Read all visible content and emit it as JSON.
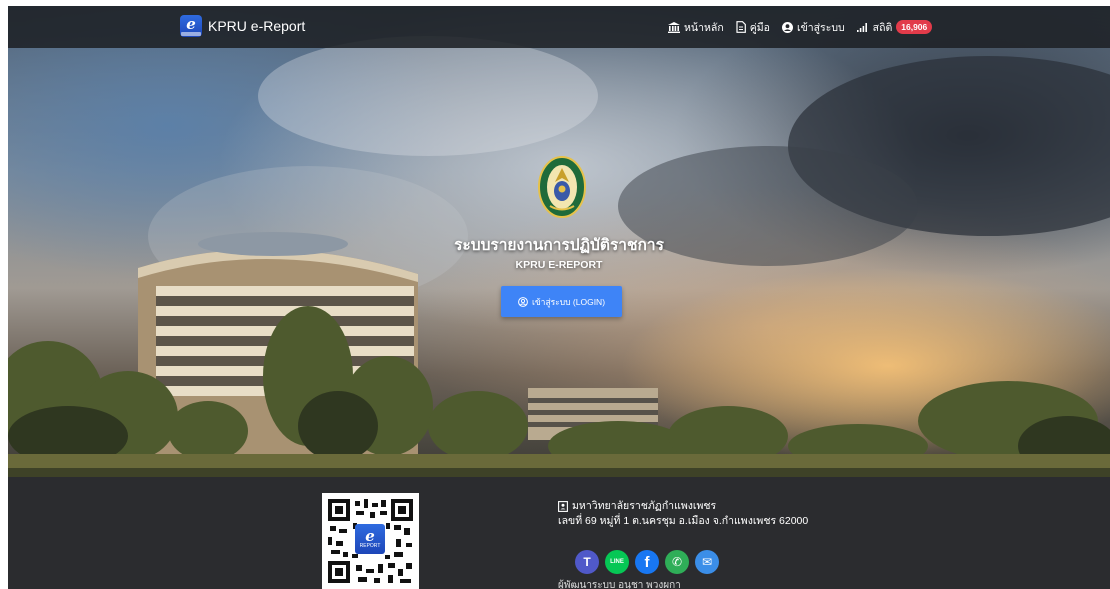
{
  "navbar": {
    "brand": "KPRU e-Report",
    "brand_logo_letter": "e",
    "home_label": "หน้าหลัก",
    "manual_label": "คู่มือ",
    "login_label": "เข้าสู่ระบบ",
    "stats_label": "สถิติ",
    "stats_count": "16,906"
  },
  "hero": {
    "title_th": "ระบบรายงานการปฏิบัติราชการ",
    "title_en": "KPRU E-REPORT",
    "login_button": "เข้าสู่ระบบ (LOGIN)"
  },
  "footer": {
    "qr_logo_letter": "e",
    "qr_logo_text": "REPORT",
    "university": "มหาวิทยาลัยราชภัฏกำแพงเพชร",
    "address": "เลขที่ 69 หมู่ที่ 1 ต.นครชุม อ.เมือง จ.กำแพงเพชร 62000",
    "developer": "ผู้พัฒนาระบบ อนุชา พวงผกา",
    "social": [
      {
        "name": "teams-icon",
        "glyph": "T",
        "color": "#5059c9"
      },
      {
        "name": "line-icon",
        "glyph": "LINE",
        "color": "#06c755"
      },
      {
        "name": "facebook-icon",
        "glyph": "f",
        "color": "#1877f2"
      },
      {
        "name": "phone-icon",
        "glyph": "✆",
        "color": "#2fae58"
      },
      {
        "name": "email-icon",
        "glyph": "✉",
        "color": "#3b8ee8"
      }
    ]
  },
  "colors": {
    "navbar_bg": "#1e2126",
    "login_button": "#3e84f7",
    "badge": "#e23b4a",
    "footer_bg": "#2b2c2f"
  }
}
